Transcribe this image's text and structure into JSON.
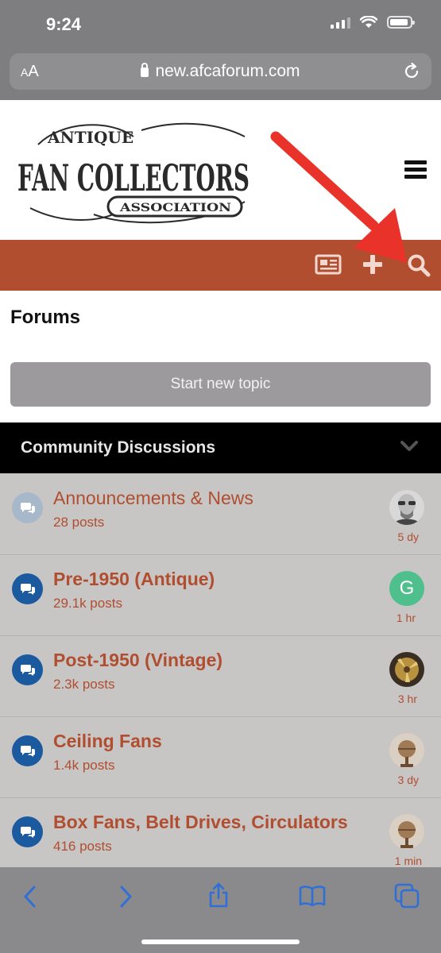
{
  "status_bar": {
    "time": "9:24"
  },
  "browser": {
    "aa_label_small": "A",
    "aa_label_big": "A",
    "url": "new.afcaforum.com"
  },
  "site": {
    "logo_text_top": "ANTIQUE",
    "logo_text_main": "FAN COLLECTORS",
    "logo_text_badge": "ASSOCIATION"
  },
  "page": {
    "title": "Forums",
    "new_topic_label": "Start new topic"
  },
  "section": {
    "title": "Community Discussions"
  },
  "forums": [
    {
      "title": "Announcements & News",
      "posts": "28 posts",
      "time": "5 dy",
      "avatar": "photo-man"
    },
    {
      "title": "Pre-1950 (Antique)",
      "posts": "29.1k posts",
      "time": "1 hr",
      "avatar_letter": "G"
    },
    {
      "title": "Post-1950 (Vintage)",
      "posts": "2.3k posts",
      "time": "3 hr",
      "avatar": "photo-fan"
    },
    {
      "title": "Ceiling Fans",
      "posts": "1.4k posts",
      "time": "3 dy",
      "avatar": "photo-fan-globe"
    },
    {
      "title": "Box Fans, Belt Drives, Circulators",
      "posts": "416 posts",
      "time": "1 min",
      "avatar": "photo-fan-globe"
    }
  ],
  "colors": {
    "accent": "#b04e2f",
    "toolbar": "#b04e2f",
    "icon_blue": "#1c5aa0",
    "annotation_arrow": "#e8322a"
  },
  "icons": [
    "newspaper-icon",
    "plus-icon",
    "search-icon",
    "hamburger-icon",
    "chevron-down-icon",
    "chat-icon",
    "back-icon",
    "forward-icon",
    "share-icon",
    "bookmarks-icon",
    "tabs-icon"
  ]
}
